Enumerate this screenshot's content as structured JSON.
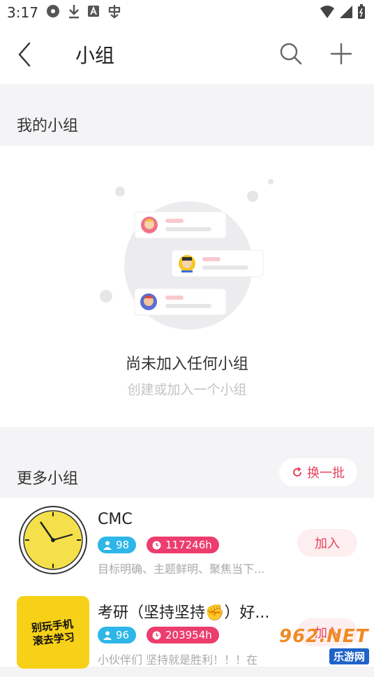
{
  "status_bar": {
    "time": "3:17"
  },
  "header": {
    "title": "小组"
  },
  "my_groups": {
    "section_title": "我的小组",
    "empty_title": "尚未加入任何小组",
    "empty_subtitle": "创建或加入一个小组"
  },
  "more_groups": {
    "section_title": "更多小组",
    "refresh_label": "换一批",
    "items": [
      {
        "name": "CMC",
        "members": "98",
        "hours": "117246h",
        "description": "目标明确、主题鲜明、聚焦当下...",
        "join_label": "加入"
      },
      {
        "name": "考研（坚持坚持✊）好...",
        "members": "96",
        "hours": "203954h",
        "description": "小伙伴们 坚持就是胜利！！！在",
        "join_label": "加入"
      }
    ]
  },
  "thumb_text": {
    "line1": "别玩手机",
    "line2": "滚去学习"
  },
  "watermark": {
    "brand": "962.NET",
    "sub": "乐游网"
  },
  "colors": {
    "accent": "#e8425b",
    "members_chip": "#2eb6e8",
    "hours_chip": "#ec3d6d"
  }
}
